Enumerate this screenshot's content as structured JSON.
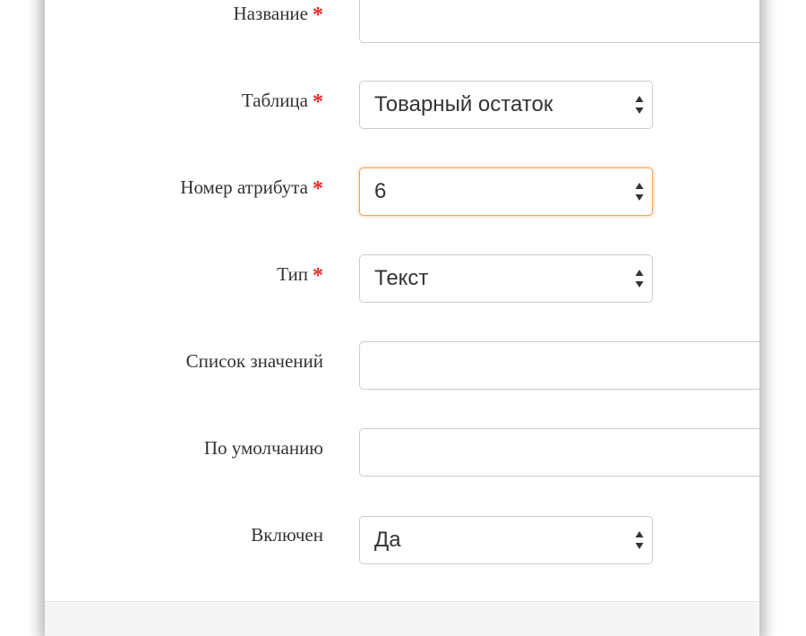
{
  "form": {
    "name": {
      "label": "Название",
      "required_mark": "*",
      "value": ""
    },
    "table": {
      "label": "Таблица",
      "required_mark": "*",
      "value": "Товарный остаток"
    },
    "attribute_number": {
      "label": "Номер атрибута",
      "required_mark": "*",
      "value": "6"
    },
    "type": {
      "label": "Тип",
      "required_mark": "*",
      "value": "Текст"
    },
    "value_list": {
      "label": "Список значений",
      "value": ""
    },
    "default": {
      "label": "По умолчанию",
      "value": ""
    },
    "enabled": {
      "label": "Включен",
      "value": "Да"
    }
  },
  "colors": {
    "required": "#e02b27",
    "focus_border": "#f0a25a",
    "input_border": "#cccccc",
    "label_text": "#333333"
  },
  "icons": {
    "select_arrows": "select-arrows-icon"
  }
}
